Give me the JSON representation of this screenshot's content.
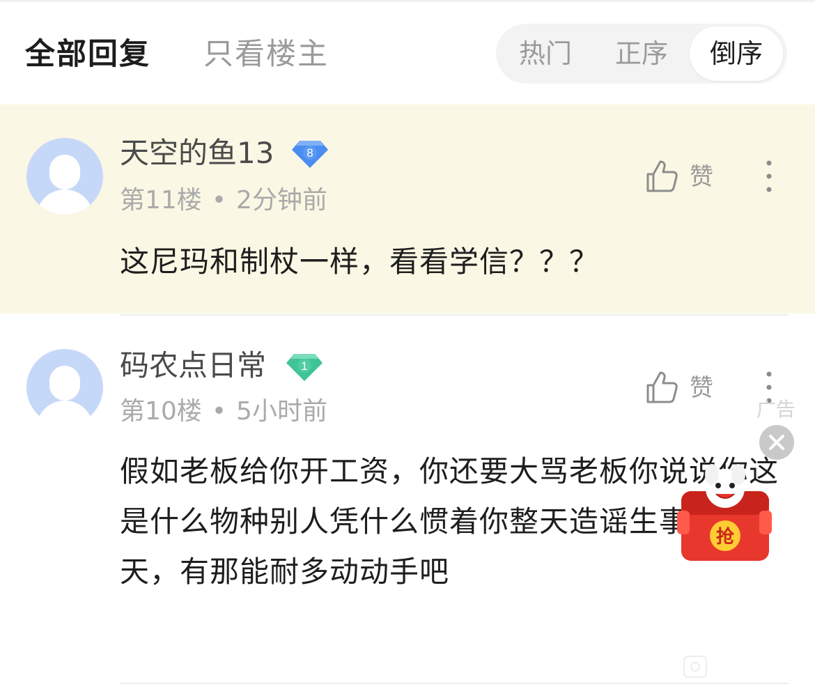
{
  "header": {
    "tab_all": "全部回复",
    "tab_op_only": "只看楼主",
    "sort_options": [
      "热门",
      "正序",
      "倒序"
    ],
    "sort_selected": "倒序"
  },
  "comments": [
    {
      "username": "天空的鱼13",
      "level_badge": "8",
      "floor": "第11楼",
      "time": "2分钟前",
      "like_label": "赞",
      "text": "这尼玛和制杖一样，看看学信？？？"
    },
    {
      "username": "码农点日常",
      "level_badge": "1",
      "floor": "第10楼",
      "time": "5小时前",
      "like_label": "赞",
      "text": "假如老板给你开工资，你还要大骂老板你说说你这是什么物种别人凭什么惯着你整天造谣生事fw十天，有那能耐多动动手吧"
    }
  ],
  "ad": {
    "label": "广告",
    "redpacket_text": "抢"
  },
  "icons": {
    "like": "thumbs-up-icon",
    "more": "more-vertical-icon",
    "badge": "diamond-level-badge-icon",
    "close": "close-icon",
    "avatar": "default-avatar-icon"
  },
  "colors": {
    "highlight_bg": "#faf7e4",
    "badge_blue": "#4a8cf0",
    "badge_green": "#3fc398",
    "text_muted": "#aaaaaa",
    "ad_red": "#e8372c"
  }
}
